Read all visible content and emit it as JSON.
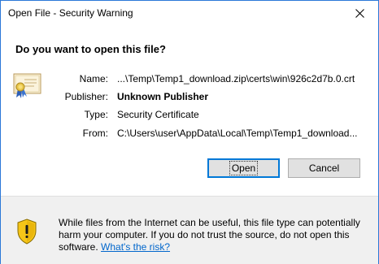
{
  "window": {
    "title": "Open File - Security Warning",
    "close_glyph": "✕"
  },
  "question": "Do you want to open this file?",
  "fields": {
    "name_label": "Name:",
    "name_value": "...\\Temp\\Temp1_download.zip\\certs\\win\\926c2d7b.0.crt",
    "publisher_label": "Publisher:",
    "publisher_value": "Unknown Publisher",
    "type_label": "Type:",
    "type_value": "Security Certificate",
    "from_label": "From:",
    "from_value": "C:\\Users\\user\\AppData\\Local\\Temp\\Temp1_download..."
  },
  "buttons": {
    "open_label": "Open",
    "cancel_label": "Cancel"
  },
  "footer": {
    "warning_text": "While files from the Internet can be useful, this file type can potentially harm your computer. If you do not trust the source, do not open this software. ",
    "risk_link": "What's the risk?"
  },
  "icons": {
    "certificate": "certificate-icon",
    "shield": "warning-shield-icon",
    "close": "close-icon"
  },
  "colors": {
    "accent": "#0078d7",
    "link": "#0066cc",
    "footer_bg": "#f0f0f0",
    "shield_yellow": "#f5c518"
  }
}
